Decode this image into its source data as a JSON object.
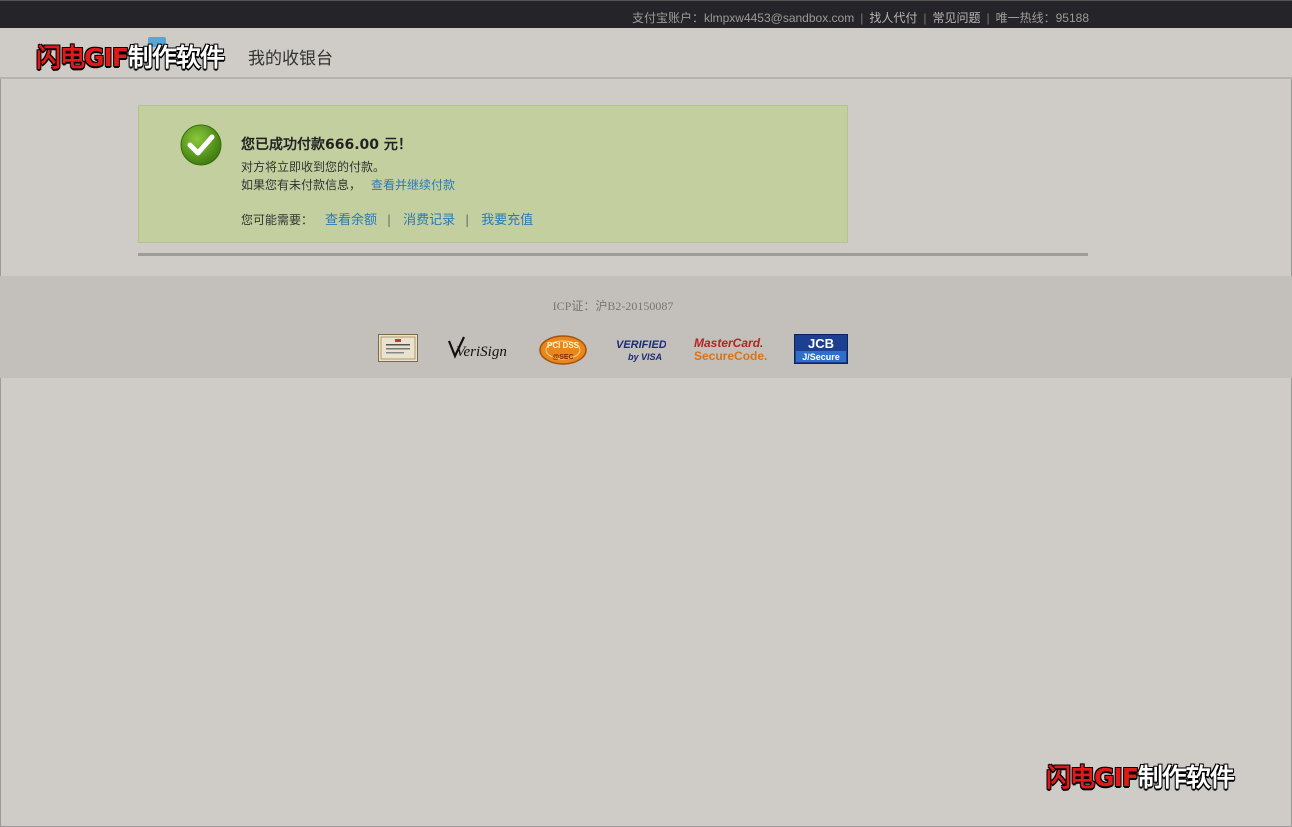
{
  "topbar": {
    "account_label": "支付宝账户：klmpxw4453@sandbox.com",
    "links": [
      "找人代付",
      "常见问题"
    ],
    "hotline": "唯一热线：95188"
  },
  "header": {
    "title": "我的收银台"
  },
  "watermark": {
    "red_part": "闪电GIF",
    "white_part": "制作软件"
  },
  "success": {
    "title": "您已成功付款666.00 元！",
    "line1": "对方将立即收到您的付款。",
    "line2": "如果您有未付款信息，",
    "continue_link": "查看并继续付款",
    "needs_label": "您可能需要：",
    "needs_links": [
      "查看余额",
      "消费记录",
      "我要充值"
    ],
    "separator": "|"
  },
  "footer": {
    "icp": "ICP证：沪B2-20150087",
    "badges": {
      "verisign": "VeriSign",
      "pcdss_top": "PCI DSS",
      "pcdss_bottom": "@SEC",
      "visa_top": "VERIFIED",
      "visa_bottom": "by VISA",
      "mastercard_top": "MasterCard.",
      "mastercard_bottom": "SecureCode.",
      "jcb_top": "JCB",
      "jcb_bottom": "J/Secure"
    }
  },
  "colors": {
    "topbar_bg": "#252428",
    "page_bg": "#cfcbc7",
    "success_bg": "#c3cf9f",
    "link": "#2a7ab8",
    "check_green": "#5c9a1d"
  },
  "icons": {
    "check": "check-circle-icon",
    "logo": "alipay-logo-icon"
  }
}
